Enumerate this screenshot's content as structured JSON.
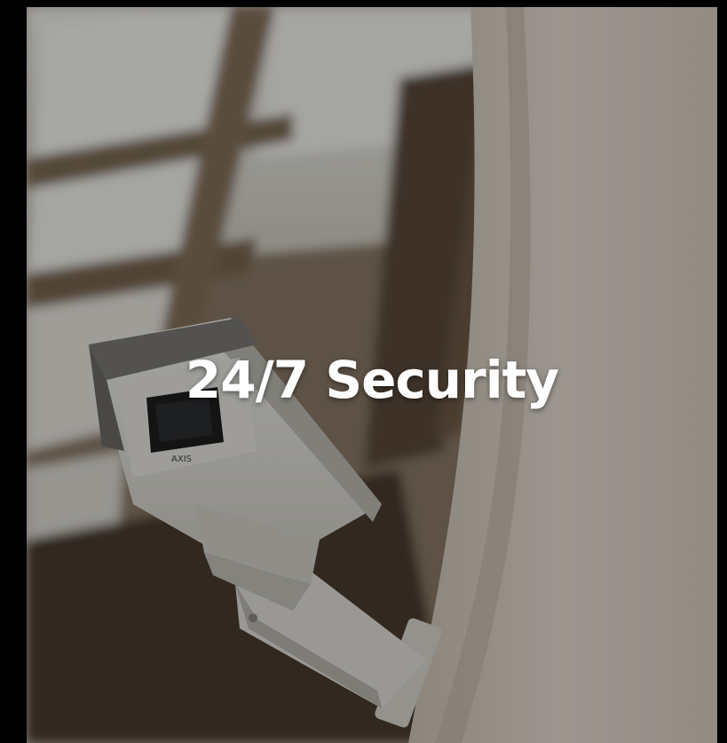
{
  "banner": {
    "title": "24/7 Security",
    "image_subject": "security-camera",
    "camera_brand": "AXIS"
  },
  "colors": {
    "page_background": "#000000",
    "title_text": "#ffffff",
    "overlay": "rgba(0,0,0,0.32)"
  }
}
